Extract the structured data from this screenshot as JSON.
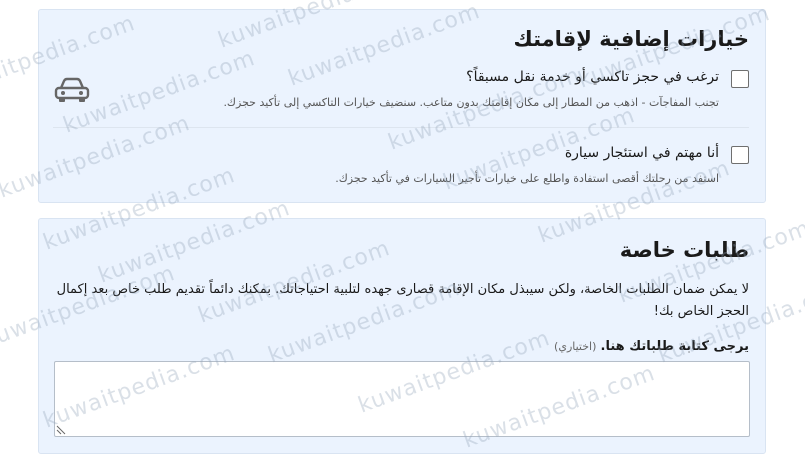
{
  "extras": {
    "title": "خيارات إضافية لإقامتك",
    "taxi": {
      "label": "ترغب في حجز تاكسي أو خدمة نقل مسبقاً؟",
      "description": "تجنب المفاجآت - اذهب من المطار إلى مكان إقامتك بدون متاعب. سنضيف خيارات التاكسي إلى تأكيد حجزك.",
      "checked": false,
      "icon": "car-icon"
    },
    "car_rental": {
      "label": "أنا مهتم في استئجار سيارة",
      "description": "استفد من رحلتك أقصى استفادة واطلع على خيارات تأجير السيارات في تأكيد حجزك.",
      "checked": false
    }
  },
  "requests": {
    "title": "طلبات خاصة",
    "body": "لا يمكن ضمان الطلبات الخاصة، ولكن سيبذل مكان الإقامة قصارى جهده لتلبية احتياجاتك. بمكنك دائماً تقديم طلب خاص بعد إكمال الحجز الخاص بك!",
    "textarea_label": "يرجى كتابة طلباتك هنا.",
    "textarea_optional": "(اختياري)",
    "textarea_value": ""
  },
  "watermark": {
    "text": "kuwaitpedia.com"
  },
  "colors": {
    "panel_background": "#ebf3fe",
    "panel_border": "#d9e4f2",
    "text": "#1a1a1a",
    "muted_text": "#555555"
  }
}
